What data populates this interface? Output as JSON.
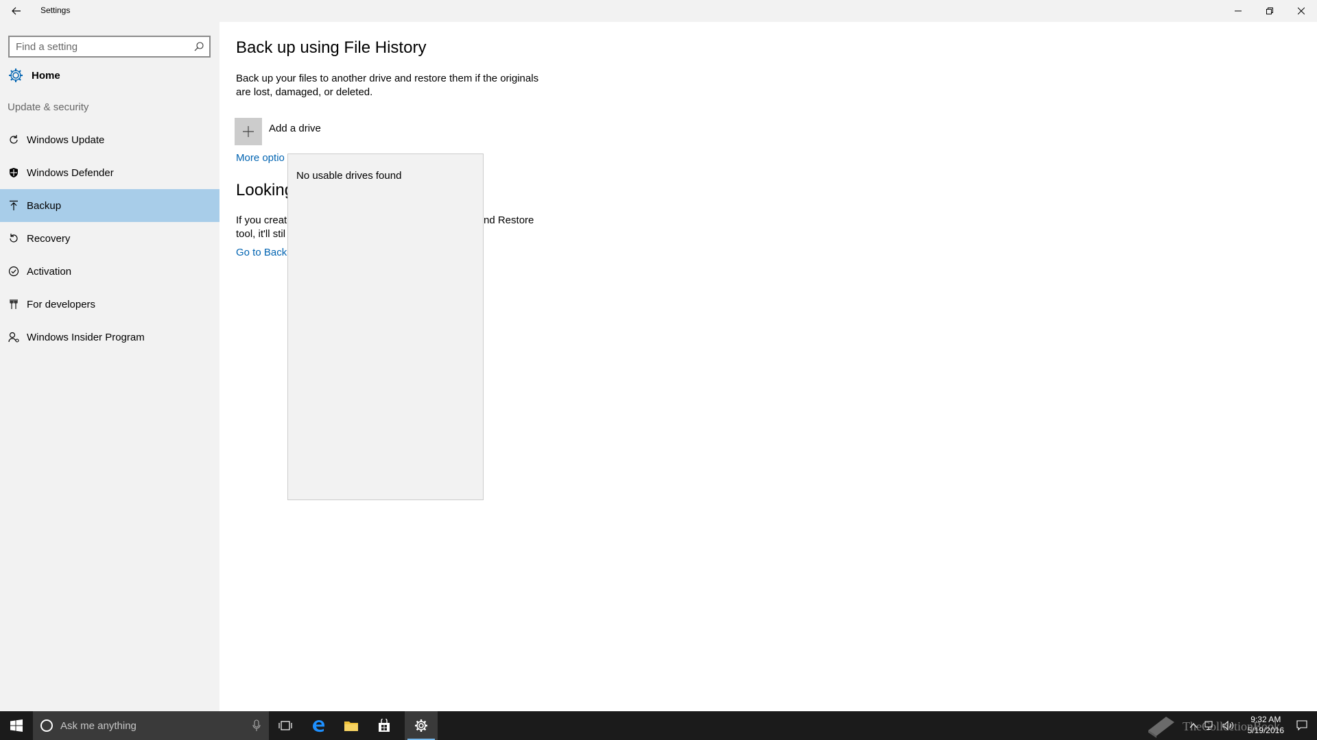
{
  "window": {
    "title": "Settings"
  },
  "sidebar": {
    "search_placeholder": "Find a setting",
    "home_label": "Home",
    "section_label": "Update & security",
    "items": [
      {
        "label": "Windows Update",
        "icon": "refresh-icon",
        "selected": false
      },
      {
        "label": "Windows Defender",
        "icon": "shield-icon",
        "selected": false
      },
      {
        "label": "Backup",
        "icon": "upload-icon",
        "selected": true
      },
      {
        "label": "Recovery",
        "icon": "history-icon",
        "selected": false
      },
      {
        "label": "Activation",
        "icon": "check-circle-icon",
        "selected": false
      },
      {
        "label": "For developers",
        "icon": "developer-tools-icon",
        "selected": false
      },
      {
        "label": "Windows Insider Program",
        "icon": "insider-person-icon",
        "selected": false
      }
    ]
  },
  "main": {
    "heading": "Back up using File History",
    "description": "Back up your files to another drive and restore them if the originals are lost, damaged, or deleted.",
    "add_drive_label": "Add a drive",
    "more_options_visible": "More optio",
    "looking_heading_visible": "Looking",
    "looking_desc_visible_line1_left": "If you creat",
    "looking_desc_visible_line1_right": "nd Restore",
    "looking_desc_visible_line2_left": "tool, it'll stil",
    "go_to_backup_visible": "Go to Backu"
  },
  "flyout": {
    "message": "No usable drives found"
  },
  "taskbar": {
    "search_placeholder": "Ask me anything",
    "time": "9:32 AM",
    "date": "5/19/2016",
    "pinned": [
      "start-icon",
      "task-view-icon",
      "edge-icon",
      "file-explorer-icon",
      "store-icon",
      "settings-icon"
    ]
  },
  "watermark": {
    "text": "TheCollectionBook"
  },
  "colors": {
    "accent": "#0063b1",
    "selected_nav": "#a8cde9",
    "sidebar_bg": "#f2f2f2",
    "taskbar_bg": "#1b1b1b"
  }
}
